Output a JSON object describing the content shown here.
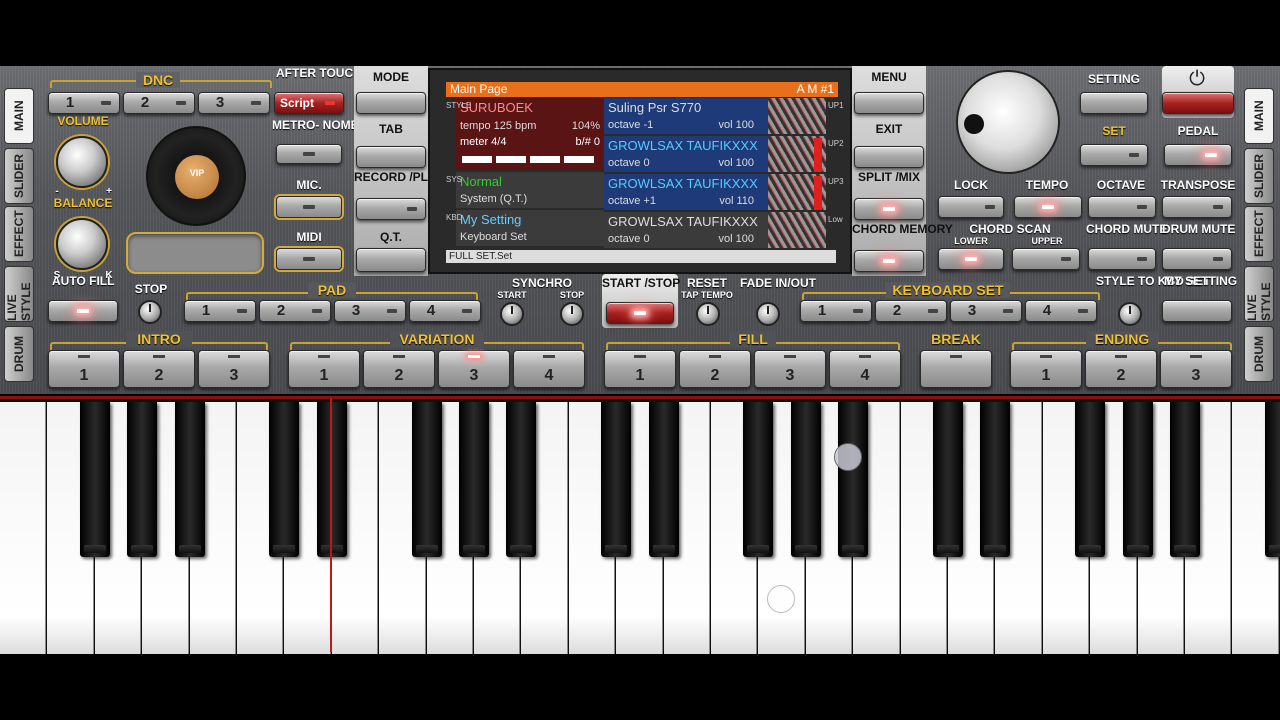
{
  "side_tabs_left": [
    "MAIN",
    "SLIDER",
    "EFFECT",
    "LIVE STYLE",
    "DRUM"
  ],
  "side_tabs_right": [
    "MAIN",
    "SLIDER",
    "EFFECT",
    "LIVE STYLE",
    "DRUM"
  ],
  "dnc": {
    "label": "DNC",
    "buttons": [
      "1",
      "2",
      "3"
    ],
    "script_label": "Script"
  },
  "after_touch": "AFTER TOUCH",
  "metronome": "METRO- NOME",
  "mic": "MIC.",
  "midi": "MIDI",
  "volume": "VOLUME",
  "balance": "BALANCE",
  "balance_s": "S",
  "balance_k": "K",
  "vol_minus": "-",
  "vol_plus": "+",
  "disc_label": "VIP",
  "mode": "MODE",
  "tab": "TAB",
  "record_play": "RECORD /PLAY",
  "qt": "Q.T.",
  "menu": "MENU",
  "exit": "EXIT",
  "split_mix": "SPLIT /MIX",
  "chord_memory": "CHORD MEMORY",
  "setting": "SETTING",
  "set": "SET",
  "pedal": "PEDAL",
  "lock": "LOCK",
  "tempo": "TEMPO",
  "octave": "OCTAVE",
  "transpose": "TRANSPOSE",
  "chord_scan": "CHORD SCAN",
  "lower": "LOWER",
  "upper": "UPPER",
  "chord_mute": "CHORD MUTE",
  "drum_mute": "DRUM MUTE",
  "lcd": {
    "header": "Main Page",
    "header_right": "A M #1",
    "style_name": "SURUBOEK",
    "tempo": "tempo 125 bpm",
    "tempo_pct": "104%",
    "meter": "meter 4/4",
    "bsharp": "b/# 0",
    "style_vlabel": "STYLE",
    "sys_vlabel": "SYS",
    "kbd_vlabel": "KBD",
    "sys_name": "Normal",
    "sys_sub": "System (Q.T.)",
    "kbd_name": "My Setting",
    "kbd_sub": "Keyboard Set",
    "footer": "FULL SET.Set",
    "upper": [
      {
        "tag": "UP1",
        "name": "Suling Psr S770",
        "octave": "octave -1",
        "vol": "vol 100"
      },
      {
        "tag": "UP2",
        "name": "GROWLSAX TAUFIKXXX",
        "octave": "octave 0",
        "vol": "vol 100"
      },
      {
        "tag": "UP3",
        "name": "GROWLSAX TAUFIKXXX",
        "octave": "octave +1",
        "vol": "vol 110"
      },
      {
        "tag": "Low",
        "name": "GROWLSAX TAUFIKXXX",
        "octave": "octave 0",
        "vol": "vol 100"
      }
    ]
  },
  "auto_fill": "AUTO FILL",
  "stop": "STOP",
  "pad": {
    "label": "PAD",
    "buttons": [
      "1",
      "2",
      "3",
      "4"
    ]
  },
  "synchro": "SYNCHRO",
  "synchro_start": "START",
  "synchro_stop": "STOP",
  "start_stop": "START /STOP",
  "reset": "RESET",
  "tap_tempo": "TAP TEMPO",
  "fade": "FADE IN/OUT",
  "keyboard_set": {
    "label": "KEYBOARD SET",
    "buttons": [
      "1",
      "2",
      "3",
      "4"
    ]
  },
  "style_to_kbd": "STYLE TO KBD SET",
  "my_setting": "MY SETTING",
  "intro": {
    "label": "INTRO",
    "buttons": [
      "1",
      "2",
      "3"
    ]
  },
  "variation": {
    "label": "VARIATION",
    "buttons": [
      "1",
      "2",
      "3",
      "4"
    ],
    "active": 3
  },
  "fill": {
    "label": "FILL",
    "buttons": [
      "1",
      "2",
      "3",
      "4"
    ]
  },
  "break": "BREAK",
  "ending": {
    "label": "ENDING",
    "buttons": [
      "1",
      "2",
      "3"
    ]
  }
}
